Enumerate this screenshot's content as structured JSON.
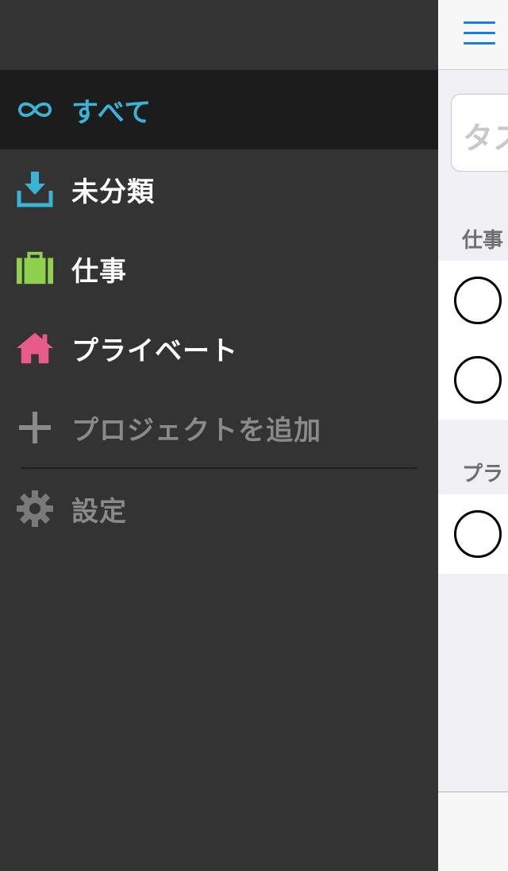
{
  "drawer": {
    "items": [
      {
        "label": "すべて",
        "icon": "infinity-icon",
        "color": "#3ab4d6",
        "active": true
      },
      {
        "label": "未分類",
        "icon": "inbox-download-icon",
        "color": "#3ab4d6"
      },
      {
        "label": "仕事",
        "icon": "briefcase-icon",
        "color": "#8fd14f"
      },
      {
        "label": "プライベート",
        "icon": "home-icon",
        "color": "#e85a8a"
      },
      {
        "label": "プロジェクトを追加",
        "icon": "plus-icon",
        "color": "#8a8a8a"
      },
      {
        "label": "設定",
        "icon": "gear-icon",
        "color": "#7a7a7a"
      }
    ]
  },
  "main": {
    "search_placeholder": "タス",
    "sections": [
      {
        "title": "仕事",
        "task_count": 2
      },
      {
        "title": "プラ",
        "task_count": 1
      }
    ]
  }
}
